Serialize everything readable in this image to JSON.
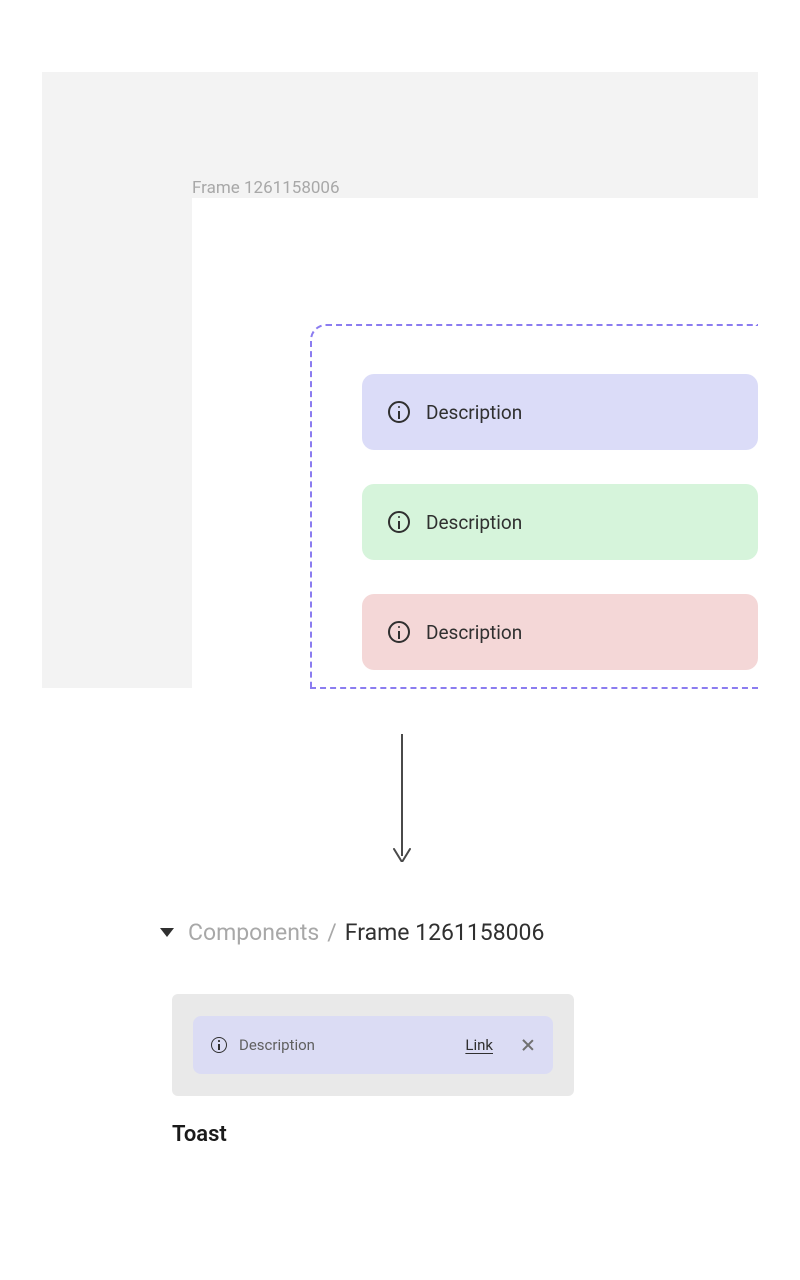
{
  "canvas": {
    "frame_label": "Frame 1261158006",
    "toasts": [
      {
        "text": "Description",
        "variant": "lavender"
      },
      {
        "text": "Description",
        "variant": "mint"
      },
      {
        "text": "Description",
        "variant": "rose"
      }
    ]
  },
  "breadcrumb": {
    "parent": "Components",
    "separator": "/",
    "current": "Frame 1261158006"
  },
  "preview": {
    "description": "Description",
    "link_label": "Link"
  },
  "component": {
    "name": "Toast"
  }
}
